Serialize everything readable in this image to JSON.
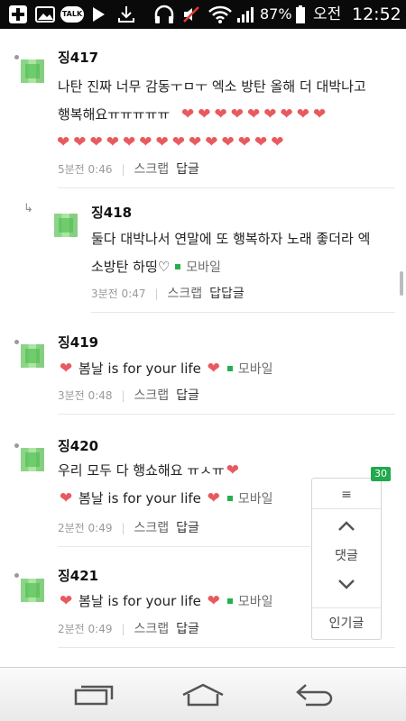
{
  "statusbar": {
    "battery_percent": "87%",
    "ampm": "오전",
    "time": "12:52",
    "talk_label": "TALK"
  },
  "comments": [
    {
      "username": "징417",
      "text_line1": "나탄 진짜 너무 감동ㅜㅁㅜ 엑소 방탄 올해 더 대박나고",
      "text_line2": "행복해요ㅠㅠㅠㅠㅠ",
      "hearts_line2": 9,
      "hearts_line3": 14,
      "time": "5분전 0:46",
      "scrap": "스크랩",
      "reply": "답글"
    },
    {
      "username": "징418",
      "text_line1": "둘다 대박나서 연말에 또 행복하자 노래 좋더라 엑",
      "text_line2": "소방탄 하띵♡",
      "mobile": "모바일",
      "time": "3분전 0:47",
      "scrap": "스크랩",
      "reply": "답답글"
    },
    {
      "username": "징419",
      "text": "봄날 is for your life",
      "mobile": "모바일",
      "time": "3분전 0:48",
      "scrap": "스크랩",
      "reply": "답글"
    },
    {
      "username": "징420",
      "text_line1": "우리 모두 다 행쇼해요 ㅠㅅㅠ",
      "text_line2": "봄날 is for your life",
      "mobile": "모바일",
      "time": "2분전 0:49",
      "scrap": "스크랩",
      "reply": "답글"
    },
    {
      "username": "징421",
      "text": "봄날 is for your life",
      "mobile": "모바일",
      "time": "2분전 0:49",
      "scrap": "스크랩",
      "reply": "답글"
    }
  ],
  "panel": {
    "badge": "30",
    "menu_icon": "≡",
    "comments_label": "댓글",
    "popular_label": "인기글"
  },
  "colors": {
    "heart": "#e85a5f",
    "mobile_square": "#23b14d",
    "badge": "#20a94d"
  }
}
